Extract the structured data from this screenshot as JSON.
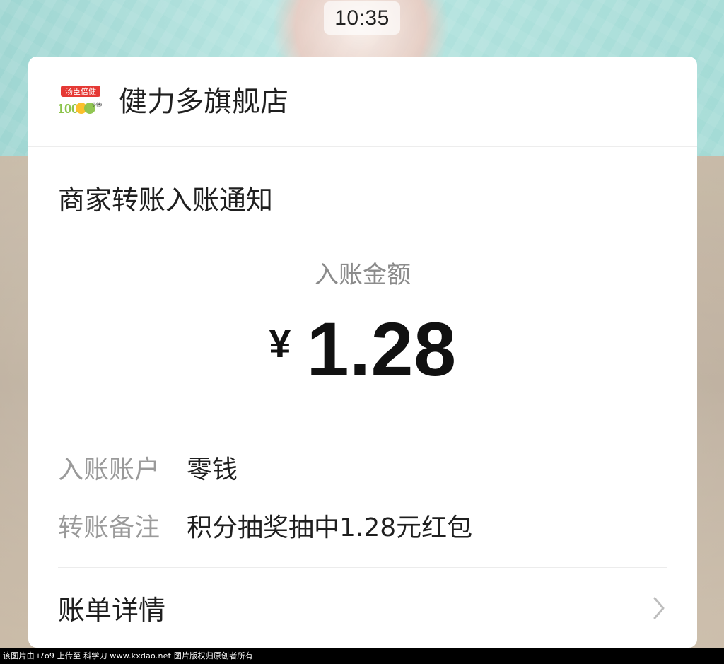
{
  "status": {
    "time": "10:35"
  },
  "merchant": {
    "logo_text_top": "汤臣倍健",
    "logo_text_bottom": "100",
    "logo_text_small": "小健康",
    "name": "健力多旗舰店"
  },
  "notice": {
    "title": "商家转账入账通知",
    "amount_label": "入账金额",
    "amount_currency": "¥",
    "amount_value": "1.28"
  },
  "details": {
    "rows": [
      {
        "label": "入账账户",
        "value": "零钱"
      },
      {
        "label": "转账备注",
        "value": "积分抽奖抽中1.28元红包"
      }
    ]
  },
  "bill": {
    "label": "账单详情",
    "chevron_icon": "chevron-right-icon"
  },
  "footer": {
    "text": "该图片由 i7o9 上传至 科学刀 www.kxdao.net 图片版权归原创者所有"
  },
  "colors": {
    "card_bg": "#ffffff",
    "muted_text": "#9a9a9a",
    "primary_text": "#1f1f1f",
    "logo_red": "#e53935",
    "logo_green": "#8bc34a",
    "logo_yellow": "#fbc02d"
  }
}
